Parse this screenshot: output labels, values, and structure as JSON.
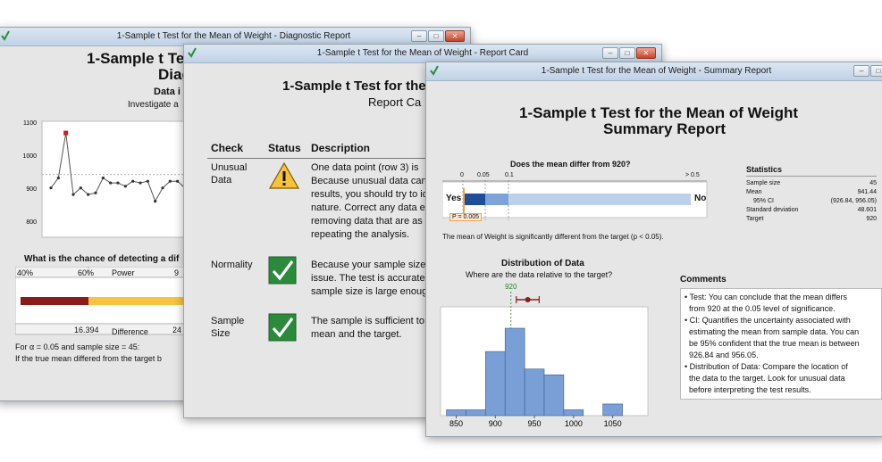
{
  "diagnostic": {
    "window_title": "1-Sample t Test for the Mean of Weight - Diagnostic Report",
    "title_line1": "1-Sample t Tes",
    "title_line2": "Diag",
    "section_heading": "Data i",
    "section_sub": "Investigate a",
    "chart_y_ticks": [
      "1100",
      "1000",
      "900",
      "800"
    ],
    "power_question": "What is the chance of detecting a dif",
    "power_axis": {
      "tick_40": "40%",
      "tick_60": "60%",
      "label": "Power",
      "tick_9x": "9"
    },
    "difference_axis": {
      "tick_a": "16.394",
      "label": "Difference",
      "tick_b": "24"
    },
    "footer_line1": "For α = 0.05 and sample size = 45:",
    "footer_line2": "If the true mean differed from the target b",
    "chart_data": {
      "type": "line",
      "ylim": [
        800,
        1100
      ],
      "reference_y": 940,
      "y": [
        900,
        930,
        1065,
        880,
        900,
        880,
        885,
        930,
        915,
        915,
        905,
        920,
        915,
        920,
        860,
        900,
        920,
        920,
        900
      ],
      "highlight_index": 2
    },
    "colors": {
      "power_low": "#8b1c1c",
      "power_high": "#f5c542",
      "highlight": "#d21a1a"
    }
  },
  "report_card": {
    "window_title": "1-Sample t Test for the Mean of Weight - Report Card",
    "title_line1": "1-Sample t Test for the",
    "title_line2": "Report Ca",
    "headers": {
      "check": "Check",
      "status": "Status",
      "description": "Description"
    },
    "rows": [
      {
        "check_line1": "Unusual",
        "check_line2": "Data",
        "status_icon": "warning-icon",
        "description": [
          "One data point (row 3) is",
          "Because unusual data can",
          "results, you should try to id",
          "nature. Correct any data e",
          "removing data that are as",
          "repeating the analysis."
        ]
      },
      {
        "check_line1": "Normality",
        "check_line2": "",
        "status_icon": "check-icon",
        "description": [
          "Because your sample size",
          "issue. The test is accurate",
          "sample size is large enoug"
        ]
      },
      {
        "check_line1": "Sample",
        "check_line2": "Size",
        "status_icon": "check-icon",
        "description": [
          "The sample is sufficient to",
          "mean and the target."
        ]
      }
    ]
  },
  "summary": {
    "window_title": "1-Sample t Test for the Mean of Weight - Summary Report",
    "title_line1": "1-Sample t Test for the Mean of Weight",
    "title_line2": "Summary Report",
    "question": "Does the mean differ from 920?",
    "pscale": {
      "t0": "0",
      "t005": "0.05",
      "t01": "0.1",
      "t05": "> 0.5",
      "yes": "Yes",
      "no": "No",
      "p_label": "P = 0.005"
    },
    "conclusion": "The mean of Weight is significantly different from the target (p < 0.05).",
    "statistics": {
      "heading": "Statistics",
      "rows": [
        {
          "label": "Sample size",
          "value": "45"
        },
        {
          "label": "Mean",
          "value": "941.44"
        },
        {
          "label": "95% CI",
          "value": "(926.84, 956.05)"
        },
        {
          "label": "Standard deviation",
          "value": "48.601"
        },
        {
          "label": "Target",
          "value": "920"
        }
      ]
    },
    "distribution": {
      "heading": "Distribution of Data",
      "sub": "Where are the data relative to the target?",
      "target_label": "920"
    },
    "comments": {
      "heading": "Comments",
      "lines": [
        "• Test: You can conclude that the mean differs",
        "from 920 at the 0.05 level of significance.",
        "• CI: Quantifies the uncertainty associated with",
        "estimating the mean from sample data. You can",
        "be 95% confident that the true mean is between",
        "926.84 and 956.05.",
        "• Distribution of Data: Compare the location of",
        "the data to the target. Look for unusual data",
        "before interpreting the test results."
      ]
    },
    "chart_data": {
      "type": "bar",
      "x_ticks": [
        "850",
        "900",
        "950",
        "1000",
        "1050"
      ],
      "bin_edges": [
        837.5,
        862.5,
        887.5,
        912.5,
        937.5,
        962.5,
        987.5,
        1012.5,
        1037.5,
        1062.5,
        1087.5
      ],
      "counts": [
        1,
        1,
        11,
        15,
        8,
        7,
        1,
        0,
        2,
        0,
        1
      ],
      "target": 920,
      "mean": 941.44,
      "ci": [
        926.84,
        956.05
      ]
    },
    "colors": {
      "bar": "#7a9fd6",
      "bar_border": "#3b5b92",
      "p_dark": "#1f4e99",
      "p_mid": "#7ea3d8",
      "p_light": "#bcd0ec",
      "p_marker": "#f2a34b",
      "ci": "#8b1c1c",
      "target": "#2e7d32"
    }
  }
}
